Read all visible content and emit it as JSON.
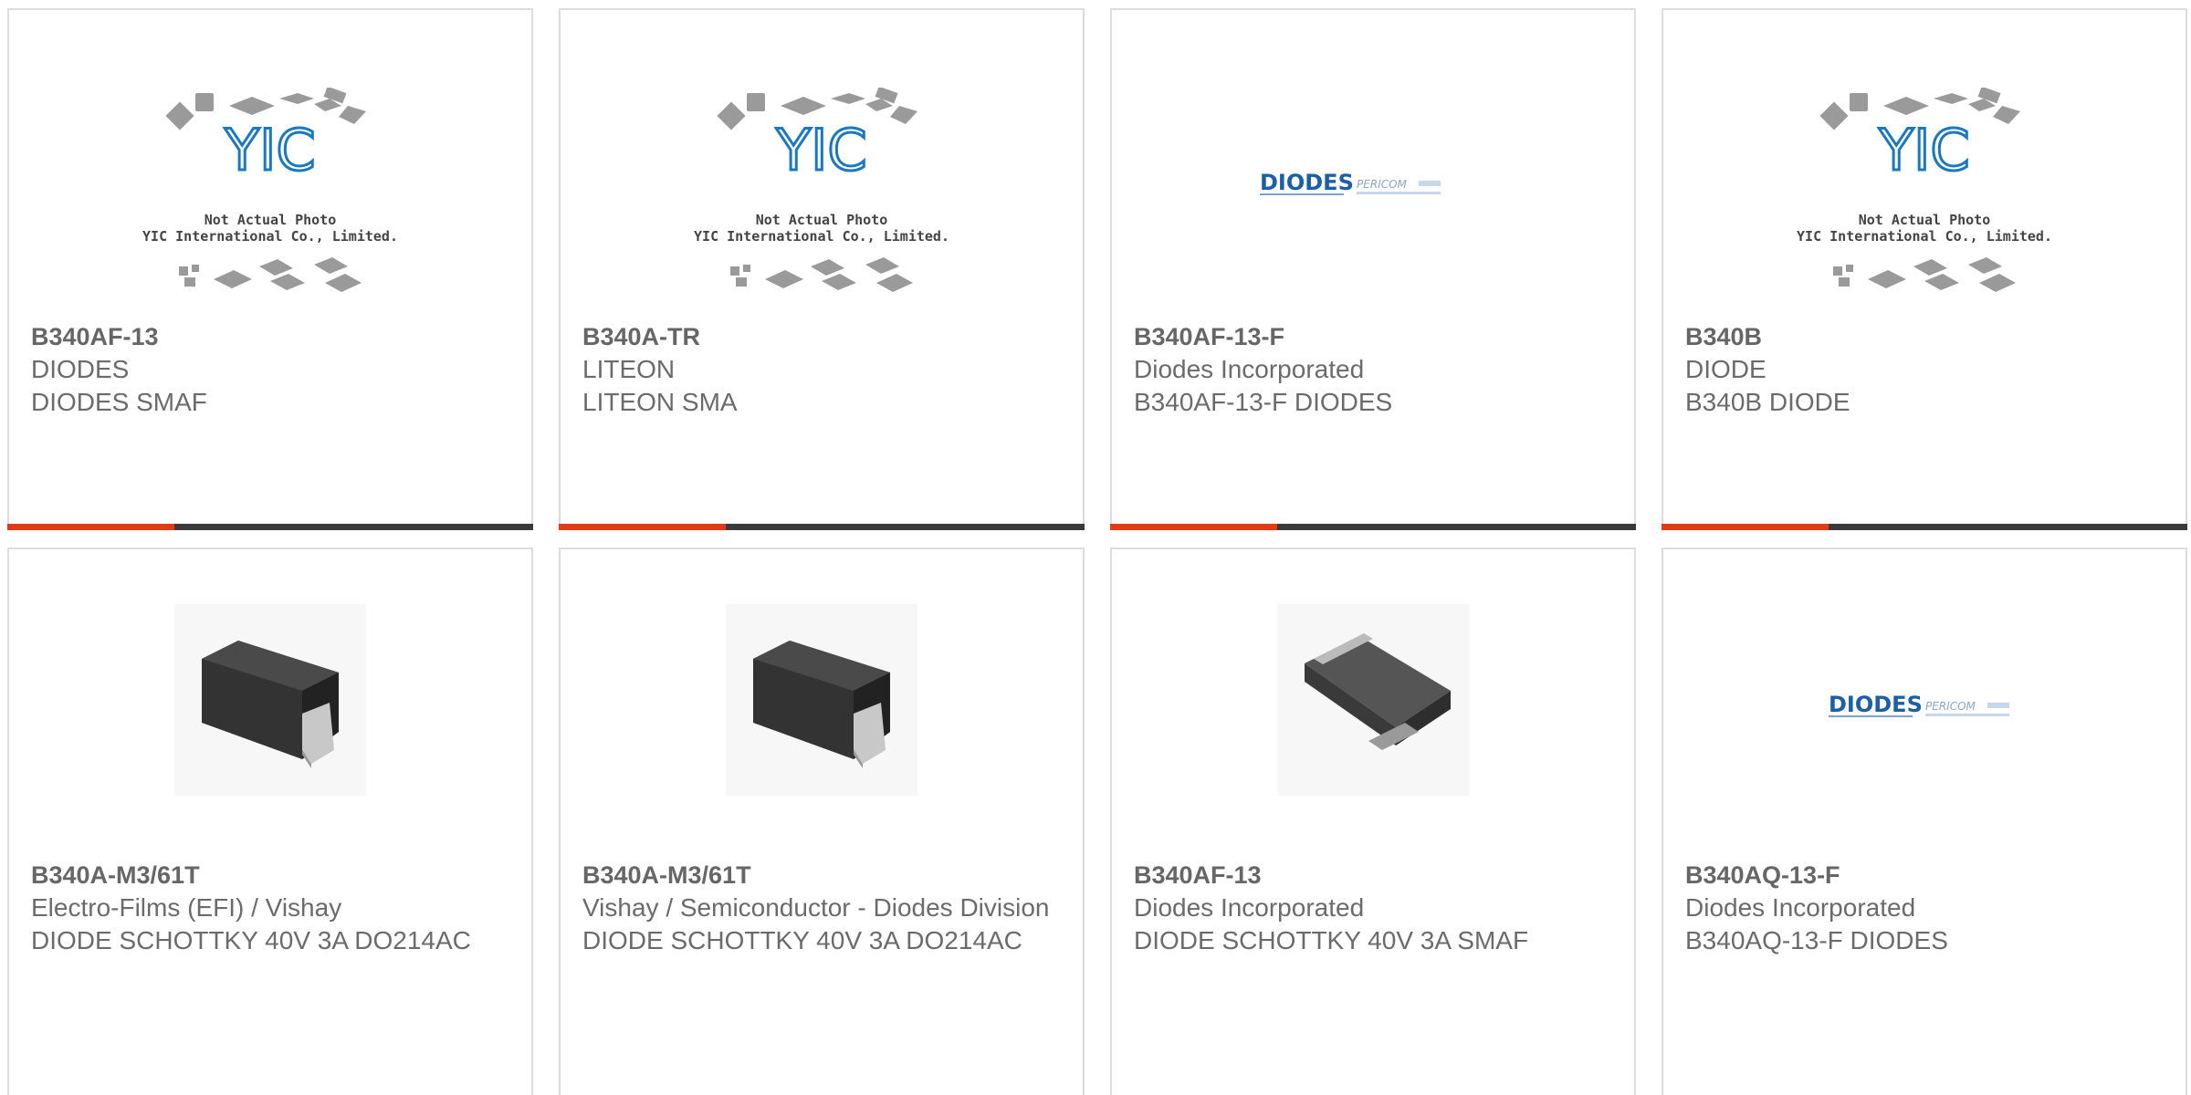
{
  "colors": {
    "accent": "#e03a16",
    "bar": "#3a3a3a",
    "diodes_blue": "#1b5fa6",
    "yic_blue": "#1a78c2"
  },
  "placeholder": {
    "line1": "Not Actual Photo",
    "line2": "YIC International Co., Limited.",
    "logo": "YIC"
  },
  "diodes_logo": {
    "name": "DIODES",
    "sub": "PERICOM"
  },
  "cards": [
    {
      "image": "yic-placeholder",
      "part": "B340AF-13",
      "maker": "DIODES",
      "desc": "DIODES SMAF"
    },
    {
      "image": "yic-placeholder",
      "part": "B340A-TR",
      "maker": "LITEON",
      "desc": "LITEON SMA"
    },
    {
      "image": "diodes-logo",
      "part": "B340AF-13-F",
      "maker": "Diodes Incorporated",
      "desc": "B340AF-13-F DIODES"
    },
    {
      "image": "yic-placeholder",
      "part": "B340B",
      "maker": "DIODE",
      "desc": "B340B DIODE"
    },
    {
      "image": "smd-package",
      "part": "B340A-M3/61T",
      "maker": "Electro-Films (EFI) / Vishay",
      "desc": "DIODE SCHOTTKY 40V 3A DO214AC"
    },
    {
      "image": "smd-package",
      "part": "B340A-M3/61T",
      "maker": "Vishay / Semiconductor - Diodes Division",
      "desc": "DIODE SCHOTTKY 40V 3A DO214AC"
    },
    {
      "image": "smaf-package",
      "part": "B340AF-13",
      "maker": "Diodes Incorporated",
      "desc": "DIODE SCHOTTKY 40V 3A SMAF"
    },
    {
      "image": "diodes-logo",
      "part": "B340AQ-13-F",
      "maker": "Diodes Incorporated",
      "desc": "B340AQ-13-F DIODES"
    }
  ]
}
